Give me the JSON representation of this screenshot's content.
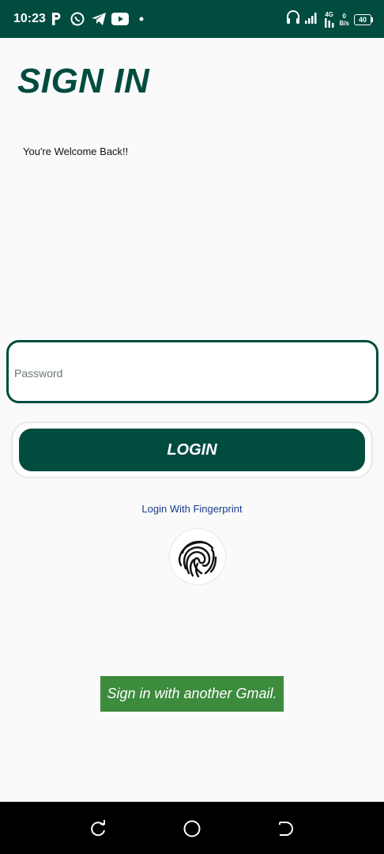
{
  "status_bar": {
    "time": "10:23",
    "network_type": "4G",
    "data_speed_value": "0",
    "data_speed_unit": "B/s",
    "battery": "40",
    "icons": [
      "p-icon",
      "whatsapp-icon",
      "telegram-icon",
      "youtube-icon",
      "dot-icon",
      "headphones-icon",
      "signal-icon",
      "network-icon",
      "battery-icon"
    ]
  },
  "page": {
    "title": "SIGN IN",
    "welcome": "You're Welcome Back!!"
  },
  "form": {
    "password_placeholder": "Password",
    "password_value": "",
    "login_label": "LOGIN"
  },
  "fingerprint": {
    "label": "Login With Fingerprint"
  },
  "alt_signin": {
    "label": "Sign in with another Gmail."
  },
  "colors": {
    "primary": "#004c3f",
    "gmail_button": "#3d8b3d",
    "link": "#1b3a8f",
    "background": "#fafafa"
  }
}
